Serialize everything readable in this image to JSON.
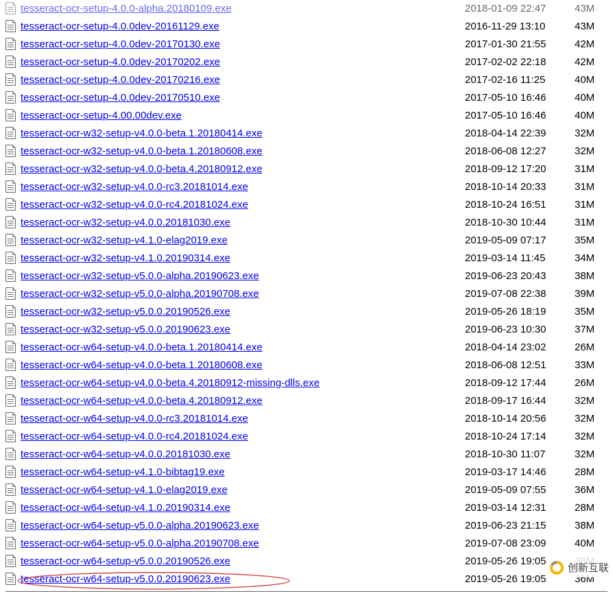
{
  "watermark_text": "创新互联",
  "files": [
    {
      "name": "tesseract-ocr-setup-4.0.0-alpha.20180109.exe",
      "date": "2018-01-09 22:47",
      "size": "43M",
      "highlight": false,
      "cut": true
    },
    {
      "name": "tesseract-ocr-setup-4.0.0dev-20161129.exe",
      "date": "2016-11-29 13:10",
      "size": "43M",
      "highlight": false,
      "cut": false
    },
    {
      "name": "tesseract-ocr-setup-4.0.0dev-20170130.exe",
      "date": "2017-01-30 21:55",
      "size": "42M",
      "highlight": false,
      "cut": false
    },
    {
      "name": "tesseract-ocr-setup-4.0.0dev-20170202.exe",
      "date": "2017-02-02 22:18",
      "size": "42M",
      "highlight": false,
      "cut": false
    },
    {
      "name": "tesseract-ocr-setup-4.0.0dev-20170216.exe",
      "date": "2017-02-16 11:25",
      "size": "40M",
      "highlight": false,
      "cut": false
    },
    {
      "name": "tesseract-ocr-setup-4.0.0dev-20170510.exe",
      "date": "2017-05-10 16:46",
      "size": "40M",
      "highlight": false,
      "cut": false
    },
    {
      "name": "tesseract-ocr-setup-4.00.00dev.exe",
      "date": "2017-05-10 16:46",
      "size": "40M",
      "highlight": false,
      "cut": false
    },
    {
      "name": "tesseract-ocr-w32-setup-v4.0.0-beta.1.20180414.exe",
      "date": "2018-04-14 22:39",
      "size": "32M",
      "highlight": false,
      "cut": false
    },
    {
      "name": "tesseract-ocr-w32-setup-v4.0.0-beta.1.20180608.exe",
      "date": "2018-06-08 12:27",
      "size": "32M",
      "highlight": false,
      "cut": false
    },
    {
      "name": "tesseract-ocr-w32-setup-v4.0.0-beta.4.20180912.exe",
      "date": "2018-09-12 17:20",
      "size": "31M",
      "highlight": false,
      "cut": false
    },
    {
      "name": "tesseract-ocr-w32-setup-v4.0.0-rc3.20181014.exe",
      "date": "2018-10-14 20:33",
      "size": "31M",
      "highlight": false,
      "cut": false
    },
    {
      "name": "tesseract-ocr-w32-setup-v4.0.0-rc4.20181024.exe",
      "date": "2018-10-24 16:51",
      "size": "31M",
      "highlight": false,
      "cut": false
    },
    {
      "name": "tesseract-ocr-w32-setup-v4.0.0.20181030.exe",
      "date": "2018-10-30 10:44",
      "size": "31M",
      "highlight": false,
      "cut": false
    },
    {
      "name": "tesseract-ocr-w32-setup-v4.1.0-elag2019.exe",
      "date": "2019-05-09 07:17",
      "size": "35M",
      "highlight": false,
      "cut": false
    },
    {
      "name": "tesseract-ocr-w32-setup-v4.1.0.20190314.exe",
      "date": "2019-03-14 11:45",
      "size": "34M",
      "highlight": false,
      "cut": false
    },
    {
      "name": "tesseract-ocr-w32-setup-v5.0.0-alpha.20190623.exe",
      "date": "2019-06-23 20:43",
      "size": "38M",
      "highlight": false,
      "cut": false
    },
    {
      "name": "tesseract-ocr-w32-setup-v5.0.0-alpha.20190708.exe",
      "date": "2019-07-08 22:38",
      "size": "39M",
      "highlight": false,
      "cut": false
    },
    {
      "name": "tesseract-ocr-w32-setup-v5.0.0.20190526.exe",
      "date": "2019-05-26 18:19",
      "size": "35M",
      "highlight": false,
      "cut": false
    },
    {
      "name": "tesseract-ocr-w32-setup-v5.0.0.20190623.exe",
      "date": "2019-06-23 10:30",
      "size": "37M",
      "highlight": false,
      "cut": false
    },
    {
      "name": "tesseract-ocr-w64-setup-v4.0.0-beta.1.20180414.exe",
      "date": "2018-04-14 23:02",
      "size": "26M",
      "highlight": false,
      "cut": false
    },
    {
      "name": "tesseract-ocr-w64-setup-v4.0.0-beta.1.20180608.exe",
      "date": "2018-06-08 12:51",
      "size": "33M",
      "highlight": false,
      "cut": false
    },
    {
      "name": "tesseract-ocr-w64-setup-v4.0.0-beta.4.20180912-missing-dlls.exe",
      "date": "2018-09-12 17:44",
      "size": "26M",
      "highlight": false,
      "cut": false
    },
    {
      "name": "tesseract-ocr-w64-setup-v4.0.0-beta.4.20180912.exe",
      "date": "2018-09-17 16:44",
      "size": "32M",
      "highlight": false,
      "cut": false
    },
    {
      "name": "tesseract-ocr-w64-setup-v4.0.0-rc3.20181014.exe",
      "date": "2018-10-14 20:56",
      "size": "32M",
      "highlight": false,
      "cut": false
    },
    {
      "name": "tesseract-ocr-w64-setup-v4.0.0-rc4.20181024.exe",
      "date": "2018-10-24 17:14",
      "size": "32M",
      "highlight": false,
      "cut": false
    },
    {
      "name": "tesseract-ocr-w64-setup-v4.0.0.20181030.exe",
      "date": "2018-10-30 11:07",
      "size": "32M",
      "highlight": false,
      "cut": false
    },
    {
      "name": "tesseract-ocr-w64-setup-v4.1.0-bibtag19.exe",
      "date": "2019-03-17 14:46",
      "size": "28M",
      "highlight": false,
      "cut": false
    },
    {
      "name": "tesseract-ocr-w64-setup-v4.1.0-elag2019.exe",
      "date": "2019-05-09 07:55",
      "size": "36M",
      "highlight": false,
      "cut": false
    },
    {
      "name": "tesseract-ocr-w64-setup-v4.1.0.20190314.exe",
      "date": "2019-03-14 12:31",
      "size": "28M",
      "highlight": false,
      "cut": false
    },
    {
      "name": "tesseract-ocr-w64-setup-v5.0.0-alpha.20190623.exe",
      "date": "2019-06-23 21:15",
      "size": "38M",
      "highlight": false,
      "cut": false
    },
    {
      "name": "tesseract-ocr-w64-setup-v5.0.0-alpha.20190708.exe",
      "date": "2019-07-08 23:09",
      "size": "40M",
      "highlight": false,
      "cut": false
    },
    {
      "name": "tesseract-ocr-w64-setup-v5.0.0.20190526.exe",
      "date": "2019-05-26 19:05",
      "size": "36M",
      "highlight": false,
      "cut": false
    },
    {
      "name": "tesseract-ocr-w64-setup-v5.0.0.20190623.exe",
      "date": "2019-05-26 19:05",
      "size": "36M",
      "highlight": true,
      "cut": false
    }
  ]
}
